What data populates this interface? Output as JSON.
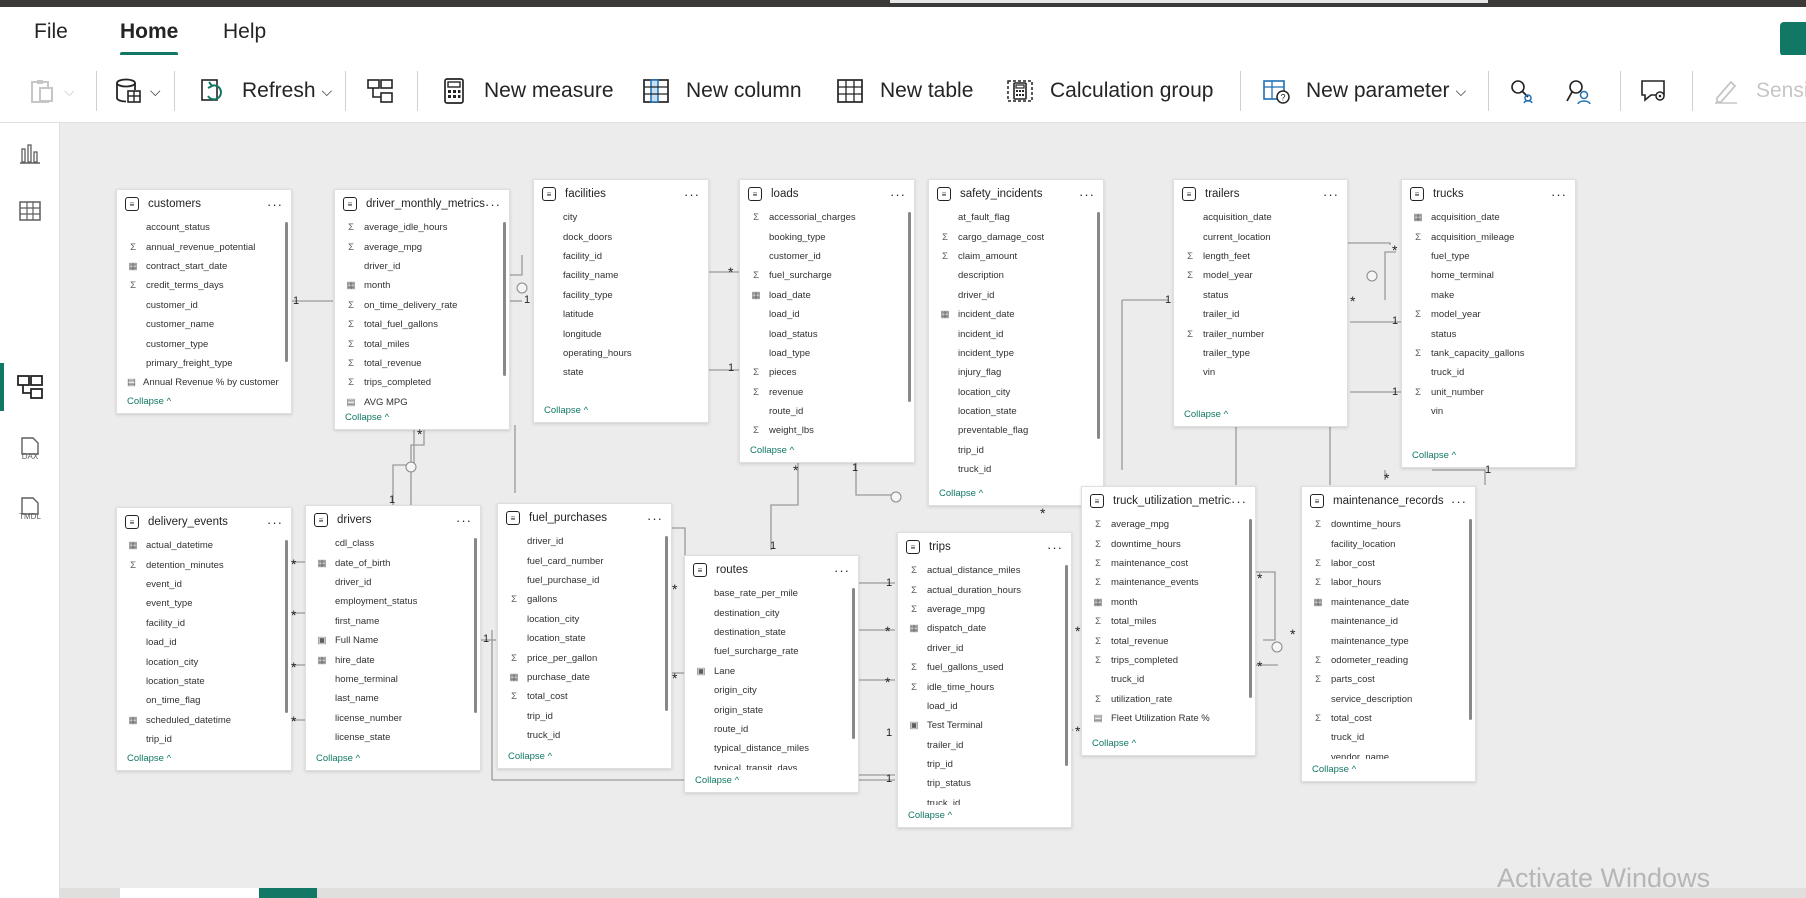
{
  "menu": {
    "items": [
      "File",
      "Home",
      "Help"
    ],
    "active": "Home"
  },
  "ribbon": {
    "refresh": "Refresh",
    "new_measure": "New measure",
    "new_column": "New column",
    "new_table": "New table",
    "calculation_group": "Calculation group",
    "new_parameter": "New parameter",
    "sensitivity": "Sensit"
  },
  "rail": [
    "report-view",
    "table-view",
    "model-view",
    "dax-query-view",
    "tmdl-view"
  ],
  "rail_labels": {
    "dax": "DAX",
    "tmdl": "TMDL"
  },
  "collapse_label": "Collapse ^",
  "tables": [
    {
      "name": "customers",
      "fields": [
        {
          "i": "",
          "t": "account_status"
        },
        {
          "i": "Σ",
          "t": "annual_revenue_potential"
        },
        {
          "i": "▦",
          "t": "contract_start_date"
        },
        {
          "i": "Σ",
          "t": "credit_terms_days"
        },
        {
          "i": "",
          "t": "customer_id"
        },
        {
          "i": "",
          "t": "customer_name"
        },
        {
          "i": "",
          "t": "customer_type"
        },
        {
          "i": "",
          "t": "primary_freight_type"
        },
        {
          "i": "▤",
          "t": "Annual Revenue % by customer t..."
        }
      ]
    },
    {
      "name": "driver_monthly_metrics",
      "fields": [
        {
          "i": "Σ",
          "t": "average_idle_hours"
        },
        {
          "i": "Σ",
          "t": "average_mpg"
        },
        {
          "i": "",
          "t": "driver_id"
        },
        {
          "i": "▦",
          "t": "month"
        },
        {
          "i": "Σ",
          "t": "on_time_delivery_rate"
        },
        {
          "i": "Σ",
          "t": "total_fuel_gallons"
        },
        {
          "i": "Σ",
          "t": "total_miles"
        },
        {
          "i": "Σ",
          "t": "total_revenue"
        },
        {
          "i": "Σ",
          "t": "trips_completed"
        },
        {
          "i": "▤",
          "t": "AVG MPG"
        }
      ]
    },
    {
      "name": "facilities",
      "fields": [
        {
          "i": "",
          "t": "city"
        },
        {
          "i": "",
          "t": "dock_doors"
        },
        {
          "i": "",
          "t": "facility_id"
        },
        {
          "i": "",
          "t": "facility_name"
        },
        {
          "i": "",
          "t": "facility_type"
        },
        {
          "i": "",
          "t": "latitude"
        },
        {
          "i": "",
          "t": "longitude"
        },
        {
          "i": "",
          "t": "operating_hours"
        },
        {
          "i": "",
          "t": "state"
        }
      ]
    },
    {
      "name": "loads",
      "fields": [
        {
          "i": "Σ",
          "t": "accessorial_charges"
        },
        {
          "i": "",
          "t": "booking_type"
        },
        {
          "i": "",
          "t": "customer_id"
        },
        {
          "i": "Σ",
          "t": "fuel_surcharge"
        },
        {
          "i": "▦",
          "t": "load_date"
        },
        {
          "i": "",
          "t": "load_id"
        },
        {
          "i": "",
          "t": "load_status"
        },
        {
          "i": "",
          "t": "load_type"
        },
        {
          "i": "Σ",
          "t": "pieces"
        },
        {
          "i": "Σ",
          "t": "revenue"
        },
        {
          "i": "",
          "t": "route_id"
        },
        {
          "i": "Σ",
          "t": "weight_lbs"
        }
      ]
    },
    {
      "name": "safety_incidents",
      "fields": [
        {
          "i": "",
          "t": "at_fault_flag"
        },
        {
          "i": "Σ",
          "t": "cargo_damage_cost"
        },
        {
          "i": "Σ",
          "t": "claim_amount"
        },
        {
          "i": "",
          "t": "description"
        },
        {
          "i": "",
          "t": "driver_id"
        },
        {
          "i": "▦",
          "t": "incident_date"
        },
        {
          "i": "",
          "t": "incident_id"
        },
        {
          "i": "",
          "t": "incident_type"
        },
        {
          "i": "",
          "t": "injury_flag"
        },
        {
          "i": "",
          "t": "location_city"
        },
        {
          "i": "",
          "t": "location_state"
        },
        {
          "i": "",
          "t": "preventable_flag"
        },
        {
          "i": "",
          "t": "trip_id"
        },
        {
          "i": "",
          "t": "truck_id"
        }
      ]
    },
    {
      "name": "trailers",
      "fields": [
        {
          "i": "",
          "t": "acquisition_date"
        },
        {
          "i": "",
          "t": "current_location"
        },
        {
          "i": "Σ",
          "t": "length_feet"
        },
        {
          "i": "Σ",
          "t": "model_year"
        },
        {
          "i": "",
          "t": "status"
        },
        {
          "i": "",
          "t": "trailer_id"
        },
        {
          "i": "Σ",
          "t": "trailer_number"
        },
        {
          "i": "",
          "t": "trailer_type"
        },
        {
          "i": "",
          "t": "vin"
        }
      ]
    },
    {
      "name": "trucks",
      "fields": [
        {
          "i": "▦",
          "t": "acquisition_date"
        },
        {
          "i": "Σ",
          "t": "acquisition_mileage"
        },
        {
          "i": "",
          "t": "fuel_type"
        },
        {
          "i": "",
          "t": "home_terminal"
        },
        {
          "i": "",
          "t": "make"
        },
        {
          "i": "Σ",
          "t": "model_year"
        },
        {
          "i": "",
          "t": "status"
        },
        {
          "i": "Σ",
          "t": "tank_capacity_gallons"
        },
        {
          "i": "",
          "t": "truck_id"
        },
        {
          "i": "Σ",
          "t": "unit_number"
        },
        {
          "i": "",
          "t": "vin"
        }
      ]
    },
    {
      "name": "delivery_events",
      "fields": [
        {
          "i": "▦",
          "t": "actual_datetime"
        },
        {
          "i": "Σ",
          "t": "detention_minutes"
        },
        {
          "i": "",
          "t": "event_id"
        },
        {
          "i": "",
          "t": "event_type"
        },
        {
          "i": "",
          "t": "facility_id"
        },
        {
          "i": "",
          "t": "load_id"
        },
        {
          "i": "",
          "t": "location_city"
        },
        {
          "i": "",
          "t": "location_state"
        },
        {
          "i": "",
          "t": "on_time_flag"
        },
        {
          "i": "▦",
          "t": "scheduled_datetime"
        },
        {
          "i": "",
          "t": "trip_id"
        }
      ]
    },
    {
      "name": "drivers",
      "fields": [
        {
          "i": "",
          "t": "cdl_class"
        },
        {
          "i": "▦",
          "t": "date_of_birth"
        },
        {
          "i": "",
          "t": "driver_id"
        },
        {
          "i": "",
          "t": "employment_status"
        },
        {
          "i": "",
          "t": "first_name"
        },
        {
          "i": "▣",
          "t": "Full Name"
        },
        {
          "i": "▦",
          "t": "hire_date"
        },
        {
          "i": "",
          "t": "home_terminal"
        },
        {
          "i": "",
          "t": "last_name"
        },
        {
          "i": "",
          "t": "license_number"
        },
        {
          "i": "",
          "t": "license_state"
        }
      ]
    },
    {
      "name": "fuel_purchases",
      "fields": [
        {
          "i": "",
          "t": "driver_id"
        },
        {
          "i": "",
          "t": "fuel_card_number"
        },
        {
          "i": "",
          "t": "fuel_purchase_id"
        },
        {
          "i": "Σ",
          "t": "gallons"
        },
        {
          "i": "",
          "t": "location_city"
        },
        {
          "i": "",
          "t": "location_state"
        },
        {
          "i": "Σ",
          "t": "price_per_gallon"
        },
        {
          "i": "▦",
          "t": "purchase_date"
        },
        {
          "i": "Σ",
          "t": "total_cost"
        },
        {
          "i": "",
          "t": "trip_id"
        },
        {
          "i": "",
          "t": "truck_id"
        }
      ]
    },
    {
      "name": "routes",
      "fields": [
        {
          "i": "",
          "t": "base_rate_per_mile"
        },
        {
          "i": "",
          "t": "destination_city"
        },
        {
          "i": "",
          "t": "destination_state"
        },
        {
          "i": "",
          "t": "fuel_surcharge_rate"
        },
        {
          "i": "▣",
          "t": "Lane"
        },
        {
          "i": "",
          "t": "origin_city"
        },
        {
          "i": "",
          "t": "origin_state"
        },
        {
          "i": "",
          "t": "route_id"
        },
        {
          "i": "",
          "t": "typical_distance_miles"
        },
        {
          "i": "",
          "t": "typical_transit_days"
        }
      ]
    },
    {
      "name": "trips",
      "fields": [
        {
          "i": "Σ",
          "t": "actual_distance_miles"
        },
        {
          "i": "Σ",
          "t": "actual_duration_hours"
        },
        {
          "i": "Σ",
          "t": "average_mpg"
        },
        {
          "i": "▦",
          "t": "dispatch_date"
        },
        {
          "i": "",
          "t": "driver_id"
        },
        {
          "i": "Σ",
          "t": "fuel_gallons_used"
        },
        {
          "i": "Σ",
          "t": "idle_time_hours"
        },
        {
          "i": "",
          "t": "load_id"
        },
        {
          "i": "▣",
          "t": "Test Terminal"
        },
        {
          "i": "",
          "t": "trailer_id"
        },
        {
          "i": "",
          "t": "trip_id"
        },
        {
          "i": "",
          "t": "trip_status"
        },
        {
          "i": "",
          "t": "truck_id"
        }
      ]
    },
    {
      "name": "truck_utilization_metrics",
      "fields": [
        {
          "i": "Σ",
          "t": "average_mpg"
        },
        {
          "i": "Σ",
          "t": "downtime_hours"
        },
        {
          "i": "Σ",
          "t": "maintenance_cost"
        },
        {
          "i": "Σ",
          "t": "maintenance_events"
        },
        {
          "i": "▦",
          "t": "month"
        },
        {
          "i": "Σ",
          "t": "total_miles"
        },
        {
          "i": "Σ",
          "t": "total_revenue"
        },
        {
          "i": "Σ",
          "t": "trips_completed"
        },
        {
          "i": "",
          "t": "truck_id"
        },
        {
          "i": "Σ",
          "t": "utilization_rate"
        },
        {
          "i": "▤",
          "t": "Fleet Utilization Rate %"
        }
      ]
    },
    {
      "name": "maintenance_records",
      "fields": [
        {
          "i": "Σ",
          "t": "downtime_hours"
        },
        {
          "i": "",
          "t": "facility_location"
        },
        {
          "i": "Σ",
          "t": "labor_cost"
        },
        {
          "i": "Σ",
          "t": "labor_hours"
        },
        {
          "i": "▦",
          "t": "maintenance_date"
        },
        {
          "i": "",
          "t": "maintenance_id"
        },
        {
          "i": "",
          "t": "maintenance_type"
        },
        {
          "i": "Σ",
          "t": "odometer_reading"
        },
        {
          "i": "Σ",
          "t": "parts_cost"
        },
        {
          "i": "",
          "t": "service_description"
        },
        {
          "i": "Σ",
          "t": "total_cost"
        },
        {
          "i": "",
          "t": "truck_id"
        },
        {
          "i": "",
          "t": "vendor_name"
        }
      ]
    }
  ],
  "cardinality": {
    "one": "1",
    "many": "*"
  },
  "watermark": "Activate Windows",
  "colors": {
    "accent": "#117865",
    "canvas": "#ececec",
    "line": "#9a9a9a"
  }
}
